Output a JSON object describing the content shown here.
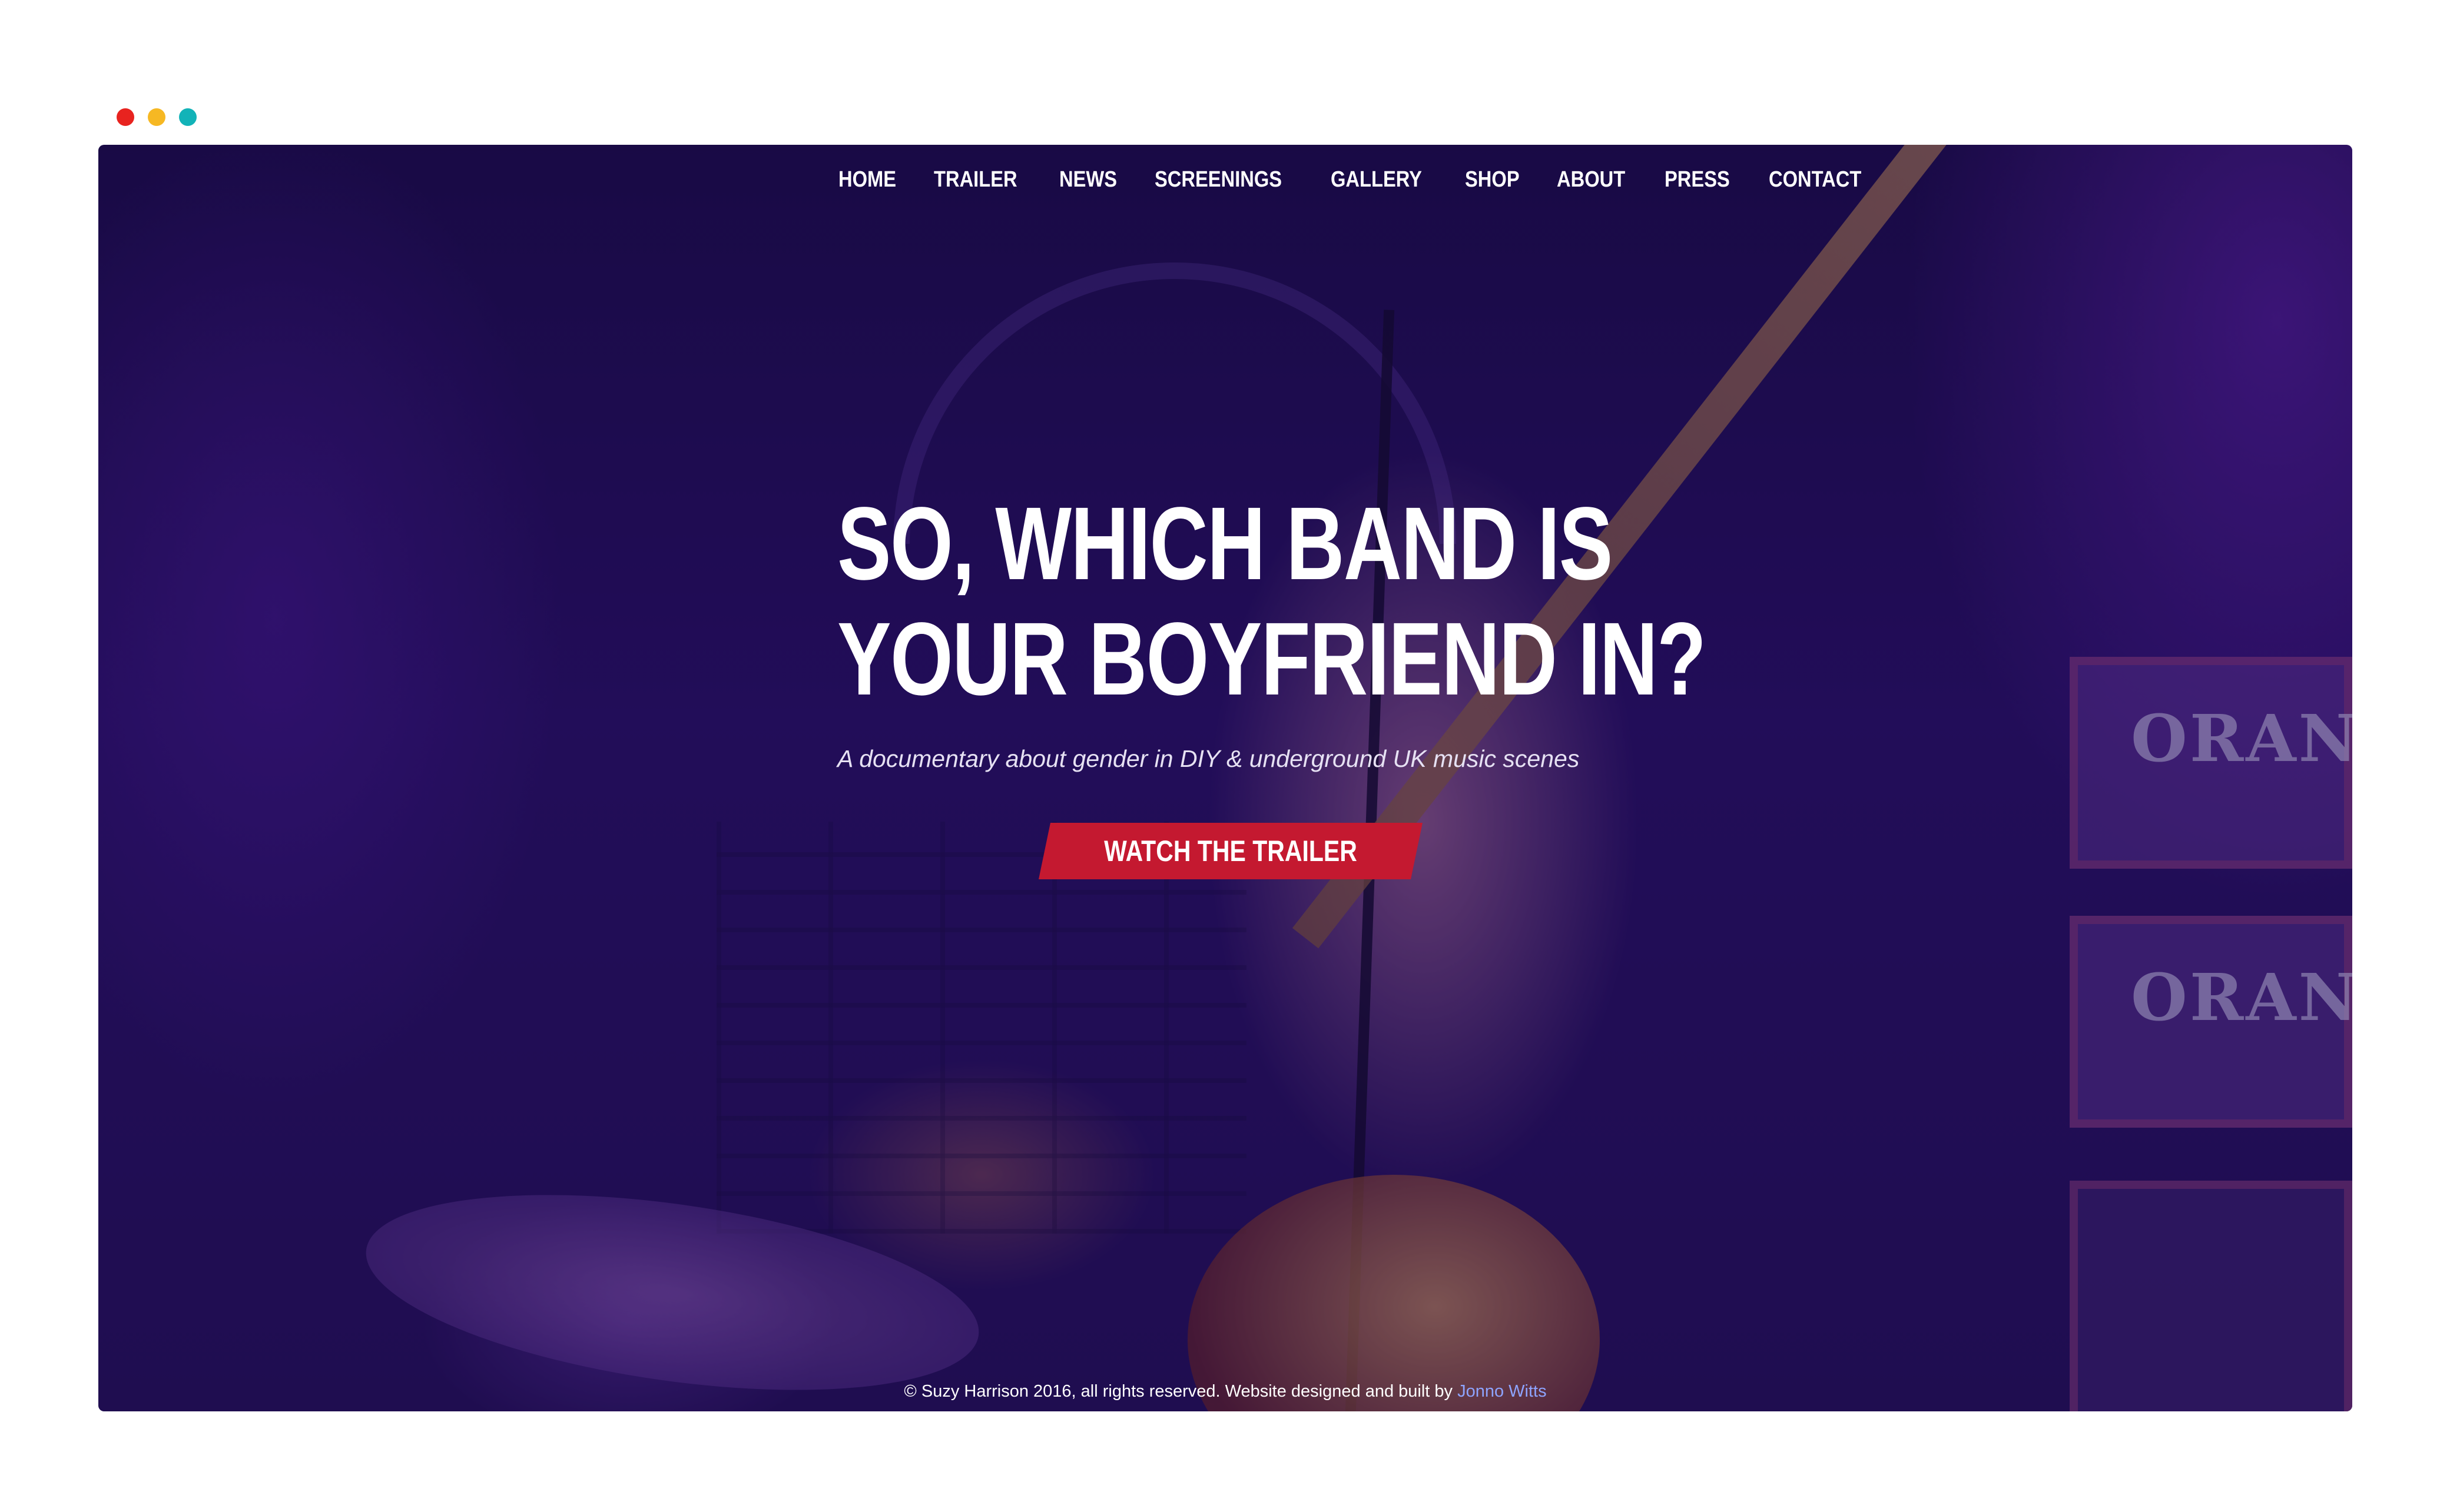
{
  "window": {
    "controls": {
      "close_color": "#e8231f",
      "minimize_color": "#f6b823",
      "maximize_color": "#12b3b8"
    }
  },
  "nav": {
    "items": [
      {
        "label": "HOME"
      },
      {
        "label": "TRAILER"
      },
      {
        "label": "NEWS"
      },
      {
        "label": "SCREENINGS"
      },
      {
        "label": "GALLERY"
      },
      {
        "label": "SHOP"
      },
      {
        "label": "ABOUT"
      },
      {
        "label": "PRESS"
      },
      {
        "label": "CONTACT"
      }
    ]
  },
  "hero": {
    "title_line1": "SO, WHICH BAND IS",
    "title_line2": "YOUR BOYFRIEND IN?",
    "subtitle": "A documentary about gender in DIY & underground UK music scenes",
    "cta_label": "WATCH THE TRAILER",
    "cta_color": "#c41930"
  },
  "background": {
    "amp_badge_1": "ORANG",
    "amp_badge_2": "ORANG",
    "overlay_color": "#2a1064"
  },
  "footer": {
    "text": "© Suzy Harrison 2016, all rights reserved. Website designed and built by ",
    "link_text": "Jonno Witts",
    "link_color": "#8ea4ff"
  }
}
